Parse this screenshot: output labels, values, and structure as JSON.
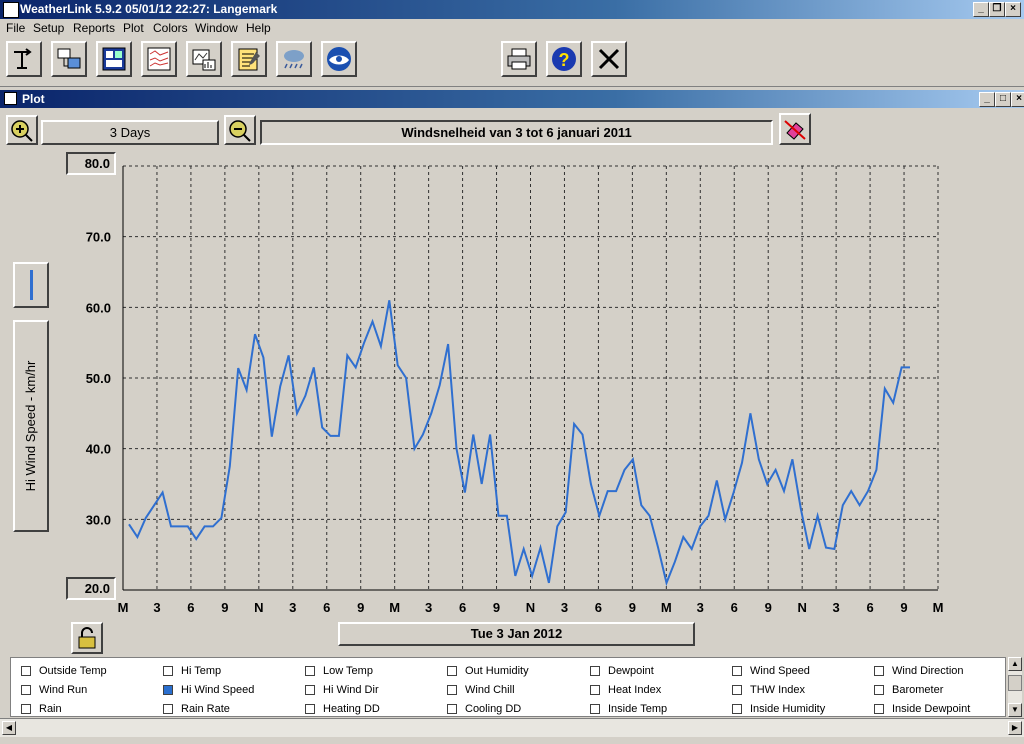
{
  "window": {
    "title": "WeatherLink 5.9.2  05/01/12  22:27: Langemark"
  },
  "menu": [
    "File",
    "Setup",
    "Reports",
    "Plot",
    "Colors",
    "Window",
    "Help"
  ],
  "plot_window": {
    "title": "Plot"
  },
  "controls": {
    "span_label": "3 Days",
    "plot_title": "Windsnelheid van 3 tot 6 januari 2011",
    "date_label": "Tue 3 Jan 2012",
    "ylabel": "Hi Wind Speed - km/hr"
  },
  "legend": [
    [
      {
        "label": "Outside Temp",
        "checked": false
      },
      {
        "label": "Hi Temp",
        "checked": false
      },
      {
        "label": "Low Temp",
        "checked": false
      },
      {
        "label": "Out Humidity",
        "checked": false
      },
      {
        "label": "Dewpoint",
        "checked": false
      },
      {
        "label": "Wind Speed",
        "checked": false
      },
      {
        "label": "Wind Direction",
        "checked": false
      }
    ],
    [
      {
        "label": "Wind Run",
        "checked": false
      },
      {
        "label": "Hi Wind Speed",
        "checked": true
      },
      {
        "label": "Hi Wind Dir",
        "checked": false
      },
      {
        "label": "Wind Chill",
        "checked": false
      },
      {
        "label": "Heat Index",
        "checked": false
      },
      {
        "label": "THW Index",
        "checked": false
      },
      {
        "label": "Barometer",
        "checked": false
      }
    ],
    [
      {
        "label": "Rain",
        "checked": false
      },
      {
        "label": "Rain Rate",
        "checked": false
      },
      {
        "label": "Heating DD",
        "checked": false
      },
      {
        "label": "Cooling DD",
        "checked": false
      },
      {
        "label": "Inside Temp",
        "checked": false
      },
      {
        "label": "Inside Humidity",
        "checked": false
      },
      {
        "label": "Inside Dewpoint",
        "checked": false
      }
    ]
  ],
  "colors": {
    "line": "#2f6fd0",
    "grid": "#303030"
  },
  "chart_data": {
    "type": "line",
    "ylabel": "Hi Wind Speed - km/hr",
    "ylim": [
      20,
      80
    ],
    "yticks": [
      "80.0",
      "70.0",
      "60.0",
      "50.0",
      "40.0",
      "30.0",
      "20.0"
    ],
    "xticks": [
      "M",
      "3",
      "6",
      "9",
      "N",
      "3",
      "6",
      "9",
      "M",
      "3",
      "6",
      "9",
      "N",
      "3",
      "6",
      "9",
      "M",
      "3",
      "6",
      "9",
      "N",
      "3",
      "6",
      "9",
      "M"
    ],
    "x_hours": [
      0,
      1,
      2,
      3,
      4,
      5,
      6,
      7,
      8,
      9,
      10,
      11,
      12,
      13,
      14,
      15,
      16,
      17,
      18,
      19,
      20,
      21,
      22,
      23,
      24,
      25,
      26,
      27,
      28,
      29,
      30,
      31,
      32,
      33,
      34,
      35,
      36,
      37,
      38,
      39,
      40,
      41,
      42,
      43,
      44,
      45,
      46,
      47,
      48,
      49,
      50,
      51,
      52,
      53,
      54,
      55,
      56,
      57,
      58,
      59,
      60,
      61,
      62,
      63,
      64,
      65,
      66,
      67,
      68,
      69,
      70,
      71,
      72,
      73,
      74,
      75,
      76,
      77,
      78,
      79,
      80,
      81,
      82,
      83,
      84,
      85,
      86,
      87,
      88,
      89,
      90,
      91,
      92,
      93
    ],
    "series": [
      {
        "values": [
          29.3,
          27.5,
          30.2,
          32.0,
          33.8,
          29.0,
          29.0,
          29.0,
          27.2,
          29.0,
          29.0,
          30.2,
          37.5,
          51.4,
          48.3,
          56.2,
          52.9,
          41.7,
          48.8,
          53.2,
          45.0,
          47.5,
          51.5,
          43.0,
          41.8,
          41.8,
          53.2,
          51.5,
          55.0,
          58.0,
          54.5,
          61.0,
          51.8,
          50.0,
          40.0,
          42.0,
          45.0,
          49.0,
          54.8,
          40.0,
          33.8,
          42.0,
          35.0,
          42.0,
          30.5,
          30.5,
          22.0,
          25.8,
          22.0,
          26.0,
          21.0,
          29.0,
          31.0,
          43.5,
          42.0,
          35.0,
          30.5,
          34.0,
          34.0,
          37.0,
          38.5,
          32.0,
          30.5,
          26.0,
          21.0,
          24.0,
          27.5,
          25.8,
          29.0,
          30.5,
          35.5,
          30.0,
          33.8,
          38.0,
          45.0,
          38.5,
          35.0,
          37.0,
          34.0,
          38.5,
          31.5,
          25.8,
          30.5,
          26.0,
          25.8,
          32.0,
          34.0,
          32.0,
          34.0,
          37.0,
          48.5,
          46.5,
          51.5,
          51.5
        ]
      }
    ]
  }
}
